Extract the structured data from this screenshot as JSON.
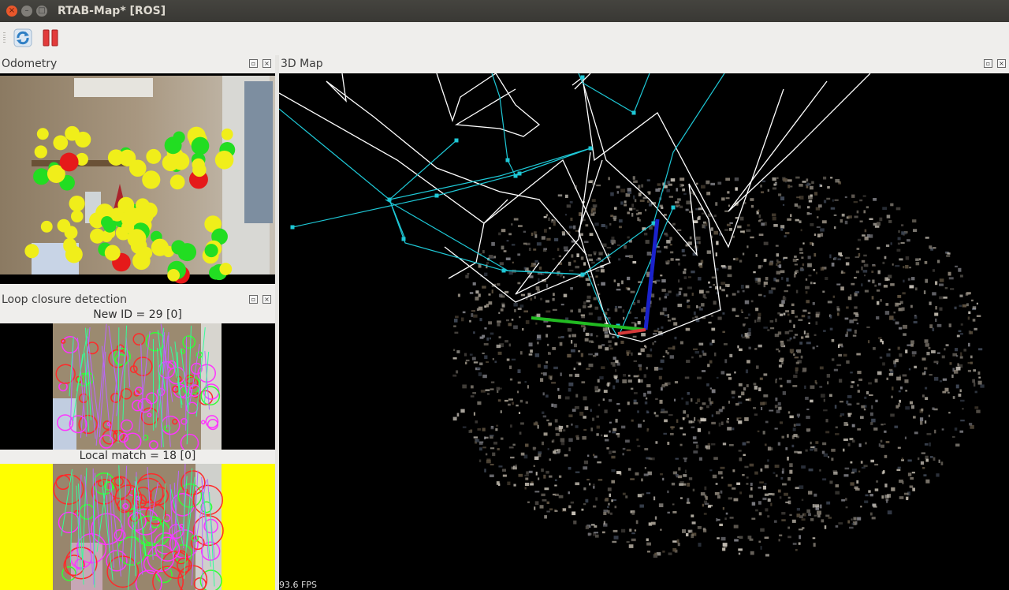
{
  "window": {
    "title": "RTAB-Map* [ROS]",
    "close_icon": "×",
    "min_icon": "–",
    "max_icon": "□"
  },
  "toolbar": {
    "buttons": [
      "refresh-icon",
      "pause-icon"
    ]
  },
  "docks": {
    "odometry": {
      "title": "Odometry"
    },
    "loop_closure": {
      "title": "Loop closure detection",
      "new_id_label": "New ID = 29 [0]",
      "local_match_label": "Local match = 18 [0]"
    },
    "map3d": {
      "title": "3D Map",
      "fps": "93.6 FPS"
    }
  },
  "colors": {
    "feature_good": "#22dd22",
    "feature_weak": "#f0ee1a",
    "feature_bad": "#e51a1a",
    "graph_link": "#1ec8d6",
    "graph_neighbor": "#ffffff",
    "axis_x": "#22bb22",
    "axis_z": "#1a22cc",
    "highlight_yellow": "#ffff00"
  }
}
